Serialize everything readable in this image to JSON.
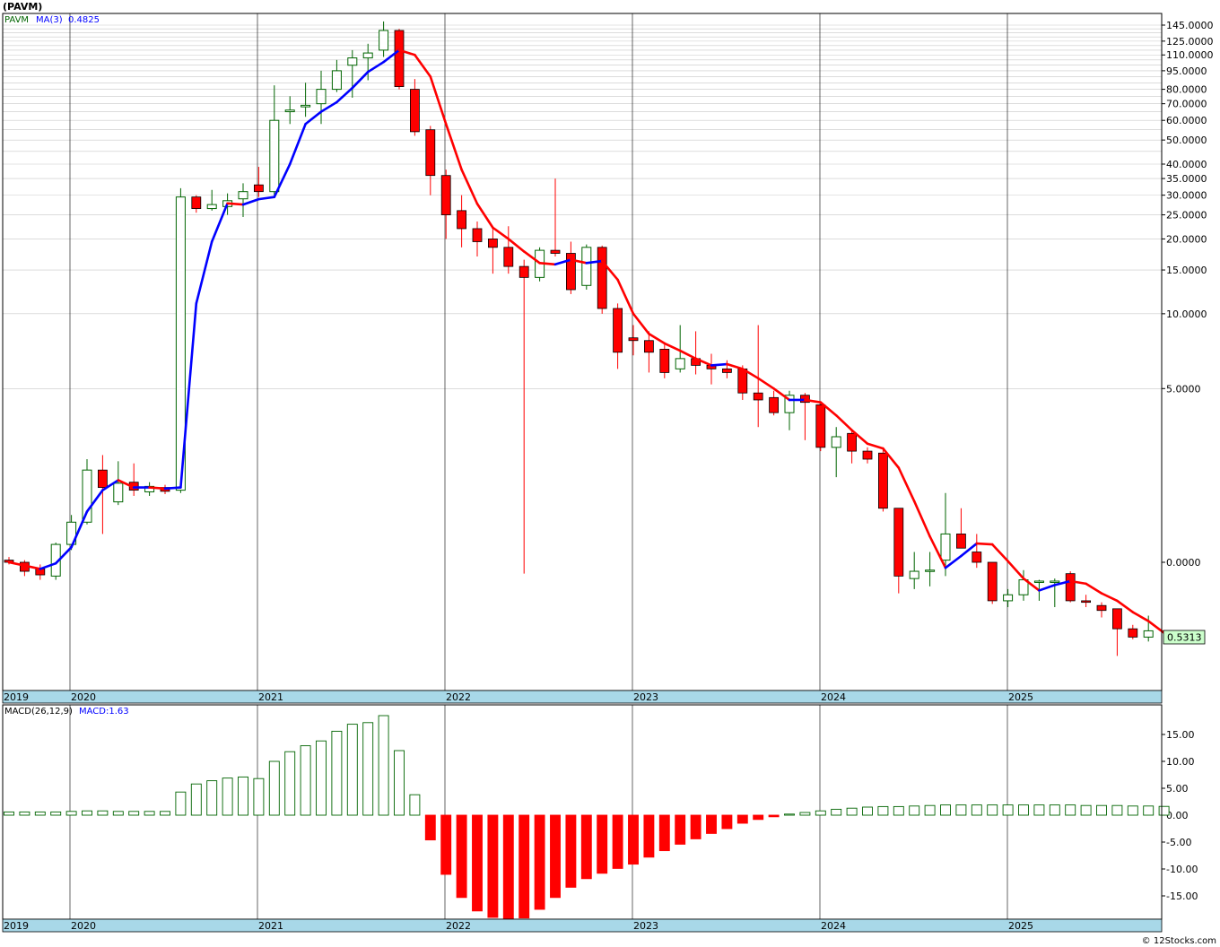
{
  "ticker_label": "(PAVM)",
  "price_legend": {
    "symbol": "PAVM",
    "ma_label": "MA(3)",
    "ma_value": "0.4825"
  },
  "macd_legend": {
    "label": "MACD(26,12,9)",
    "value_label": "MACD:1.63"
  },
  "last_price_badge": "0.5313",
  "credit": "© 12Stocks.com",
  "colors": {
    "up": "#006400",
    "down": "#ff0000",
    "ma_up": "#0000ff",
    "ma_down": "#ff0000",
    "axis_band": "#a8d8e8",
    "badge_bg": "#ccffcc"
  },
  "chart_data": [
    {
      "type": "candlestick",
      "scale": "log",
      "x_labels": [
        "2019",
        "2020",
        "2021",
        "2022",
        "2023",
        "2024",
        "2025"
      ],
      "y_tick_labels": [
        "145.0000",
        "125.0000",
        "110.0000",
        "95.0000",
        "80.0000",
        "70.0000",
        "60.0000",
        "50.0000",
        "40.0000",
        "35.0000",
        "30.0000",
        "25.0000",
        "20.0000",
        "15.0000",
        "10.0000",
        "5.0000",
        "0.0000"
      ],
      "y_ticks": [
        145,
        125,
        110,
        95,
        80,
        70,
        60,
        50,
        40,
        35,
        30,
        25,
        20,
        15,
        10,
        5,
        1
      ],
      "grid_lines": [
        145,
        140,
        135,
        130,
        125,
        120,
        115,
        110,
        105,
        100,
        95,
        90,
        85,
        80,
        75,
        70,
        65,
        60,
        55,
        50,
        45,
        40,
        35,
        30,
        25,
        20,
        15,
        10,
        5
      ],
      "candles": [
        {
          "o": 1.02,
          "h": 1.05,
          "l": 0.98,
          "c": 1.0
        },
        {
          "o": 1.0,
          "h": 1.02,
          "l": 0.88,
          "c": 0.92
        },
        {
          "o": 0.94,
          "h": 0.98,
          "l": 0.85,
          "c": 0.89
        },
        {
          "o": 0.88,
          "h": 1.2,
          "l": 0.85,
          "c": 1.18
        },
        {
          "o": 1.18,
          "h": 1.55,
          "l": 1.12,
          "c": 1.45
        },
        {
          "o": 1.45,
          "h": 2.6,
          "l": 1.42,
          "c": 2.35
        },
        {
          "o": 2.35,
          "h": 2.7,
          "l": 1.3,
          "c": 2.0
        },
        {
          "o": 1.75,
          "h": 2.55,
          "l": 1.7,
          "c": 2.08
        },
        {
          "o": 2.1,
          "h": 2.5,
          "l": 1.85,
          "c": 1.95
        },
        {
          "o": 1.92,
          "h": 2.1,
          "l": 1.85,
          "c": 2.02
        },
        {
          "o": 2.0,
          "h": 2.05,
          "l": 1.88,
          "c": 1.93
        },
        {
          "o": 1.95,
          "h": 32.0,
          "l": 1.9,
          "c": 29.5
        },
        {
          "o": 29.5,
          "h": 30.0,
          "l": 25.5,
          "c": 26.5
        },
        {
          "o": 26.5,
          "h": 31.5,
          "l": 26.0,
          "c": 27.5
        },
        {
          "o": 27.0,
          "h": 30.5,
          "l": 25.0,
          "c": 28.5
        },
        {
          "o": 29.0,
          "h": 33.5,
          "l": 24.5,
          "c": 31.0
        },
        {
          "o": 33.0,
          "h": 39.0,
          "l": 29.5,
          "c": 31.0
        },
        {
          "o": 31.0,
          "h": 83.0,
          "l": 30.0,
          "c": 60.0
        },
        {
          "o": 65.0,
          "h": 75.0,
          "l": 58.0,
          "c": 66.0
        },
        {
          "o": 68.0,
          "h": 85.0,
          "l": 62.0,
          "c": 69.0
        },
        {
          "o": 70.0,
          "h": 95.0,
          "l": 58.0,
          "c": 80.0
        },
        {
          "o": 80.0,
          "h": 105.0,
          "l": 78.0,
          "c": 95.0
        },
        {
          "o": 100.0,
          "h": 115.0,
          "l": 74.0,
          "c": 107.0
        },
        {
          "o": 107.0,
          "h": 122.0,
          "l": 87.0,
          "c": 112.0
        },
        {
          "o": 115.0,
          "h": 150.0,
          "l": 108.0,
          "c": 138.0
        },
        {
          "o": 138.0,
          "h": 140.0,
          "l": 80.0,
          "c": 82.0
        },
        {
          "o": 80.0,
          "h": 88.0,
          "l": 52.0,
          "c": 54.0
        },
        {
          "o": 55.0,
          "h": 57.0,
          "l": 30.0,
          "c": 36.0
        },
        {
          "o": 36.0,
          "h": 38.0,
          "l": 20.0,
          "c": 25.0
        },
        {
          "o": 26.0,
          "h": 30.0,
          "l": 18.5,
          "c": 22.0
        },
        {
          "o": 22.0,
          "h": 23.5,
          "l": 17.0,
          "c": 19.5
        },
        {
          "o": 20.0,
          "h": 22.0,
          "l": 14.5,
          "c": 18.5
        },
        {
          "o": 18.5,
          "h": 22.5,
          "l": 14.5,
          "c": 15.5
        },
        {
          "o": 15.5,
          "h": 16.5,
          "l": 0.9,
          "c": 14.0
        },
        {
          "o": 14.0,
          "h": 18.5,
          "l": 13.5,
          "c": 18.0
        },
        {
          "o": 18.0,
          "h": 35.0,
          "l": 17.0,
          "c": 17.5
        },
        {
          "o": 17.5,
          "h": 19.5,
          "l": 12.0,
          "c": 12.5
        },
        {
          "o": 13.0,
          "h": 19.0,
          "l": 12.5,
          "c": 18.5
        },
        {
          "o": 18.5,
          "h": 18.8,
          "l": 10.0,
          "c": 10.5
        },
        {
          "o": 10.5,
          "h": 11.0,
          "l": 6.0,
          "c": 7.0
        },
        {
          "o": 8.0,
          "h": 9.0,
          "l": 6.8,
          "c": 7.8
        },
        {
          "o": 7.8,
          "h": 8.5,
          "l": 5.8,
          "c": 7.0
        },
        {
          "o": 7.2,
          "h": 7.5,
          "l": 5.5,
          "c": 5.8
        },
        {
          "o": 6.0,
          "h": 9.0,
          "l": 5.8,
          "c": 6.6
        },
        {
          "o": 6.6,
          "h": 8.5,
          "l": 5.7,
          "c": 6.2
        },
        {
          "o": 6.2,
          "h": 6.9,
          "l": 5.2,
          "c": 6.0
        },
        {
          "o": 6.0,
          "h": 6.5,
          "l": 5.5,
          "c": 5.8
        },
        {
          "o": 6.0,
          "h": 6.2,
          "l": 4.5,
          "c": 4.8
        },
        {
          "o": 4.8,
          "h": 9.0,
          "l": 3.5,
          "c": 4.5
        },
        {
          "o": 4.6,
          "h": 4.9,
          "l": 3.9,
          "c": 4.0
        },
        {
          "o": 4.0,
          "h": 4.9,
          "l": 3.4,
          "c": 4.7
        },
        {
          "o": 4.7,
          "h": 4.8,
          "l": 3.1,
          "c": 4.4
        },
        {
          "o": 4.3,
          "h": 4.4,
          "l": 2.8,
          "c": 2.9
        },
        {
          "o": 2.9,
          "h": 3.5,
          "l": 2.2,
          "c": 3.2
        },
        {
          "o": 3.3,
          "h": 3.4,
          "l": 2.5,
          "c": 2.8
        },
        {
          "o": 2.8,
          "h": 2.9,
          "l": 2.5,
          "c": 2.6
        },
        {
          "o": 2.75,
          "h": 2.9,
          "l": 1.6,
          "c": 1.65
        },
        {
          "o": 1.65,
          "h": 1.65,
          "l": 0.75,
          "c": 0.88
        },
        {
          "o": 0.86,
          "h": 1.1,
          "l": 0.78,
          "c": 0.92
        },
        {
          "o": 0.92,
          "h": 1.1,
          "l": 0.8,
          "c": 0.93
        },
        {
          "o": 1.02,
          "h": 1.9,
          "l": 0.88,
          "c": 1.3
        },
        {
          "o": 1.3,
          "h": 1.65,
          "l": 1.15,
          "c": 1.14
        },
        {
          "o": 1.1,
          "h": 1.3,
          "l": 0.95,
          "c": 1.0
        },
        {
          "o": 1.0,
          "h": 1.0,
          "l": 0.68,
          "c": 0.7
        },
        {
          "o": 0.7,
          "h": 0.78,
          "l": 0.66,
          "c": 0.74
        },
        {
          "o": 0.74,
          "h": 0.93,
          "l": 0.7,
          "c": 0.85
        },
        {
          "o": 0.84,
          "h": 0.85,
          "l": 0.7,
          "c": 0.84
        },
        {
          "o": 0.84,
          "h": 0.86,
          "l": 0.66,
          "c": 0.84
        },
        {
          "o": 0.9,
          "h": 0.92,
          "l": 0.69,
          "c": 0.7
        },
        {
          "o": 0.7,
          "h": 0.74,
          "l": 0.66,
          "c": 0.69
        },
        {
          "o": 0.67,
          "h": 0.69,
          "l": 0.6,
          "c": 0.64
        },
        {
          "o": 0.65,
          "h": 0.65,
          "l": 0.42,
          "c": 0.54
        },
        {
          "o": 0.54,
          "h": 0.56,
          "l": 0.49,
          "c": 0.5
        },
        {
          "o": 0.5,
          "h": 0.61,
          "l": 0.48,
          "c": 0.53
        }
      ],
      "ma_values": [
        1.0,
        0.97,
        0.94,
        0.99,
        1.15,
        1.6,
        1.95,
        2.14,
        2.0,
        2.0,
        1.98,
        2.0,
        11.0,
        19.5,
        27.8,
        27.5,
        28.9,
        29.5,
        40.0,
        58.0,
        65.0,
        71.0,
        81.0,
        94.0,
        103.0,
        115.0,
        110.0,
        90.0,
        58.0,
        38.0,
        27.7,
        22.2,
        20.0,
        17.8,
        16.0,
        15.8,
        16.5,
        16.0,
        16.3,
        13.7,
        10.0,
        8.3,
        7.6,
        7.1,
        6.6,
        6.2,
        6.27,
        6.0,
        5.5,
        5.0,
        4.5,
        4.5,
        4.4,
        3.9,
        3.4,
        3.0,
        2.87,
        2.4,
        1.76,
        1.27,
        0.95,
        1.06,
        1.19,
        1.18,
        1.01,
        0.86,
        0.77,
        0.81,
        0.84,
        0.82,
        0.75,
        0.7,
        0.63,
        0.58,
        0.52
      ]
    },
    {
      "type": "histogram",
      "title": "MACD(26,12,9)",
      "y_tick_labels": [
        "15.00",
        "10.00",
        "5.00",
        "0.00",
        "-5.00",
        "-10.00",
        "-15.00"
      ],
      "y_ticks": [
        15,
        10,
        5,
        0,
        -5,
        -10,
        -15
      ],
      "ylim": [
        -19.5,
        19
      ],
      "values": [
        0.6,
        0.6,
        0.6,
        0.6,
        0.7,
        0.8,
        0.8,
        0.7,
        0.7,
        0.7,
        0.7,
        4.3,
        5.8,
        6.4,
        6.9,
        7.1,
        6.8,
        10.0,
        11.8,
        12.9,
        13.8,
        15.6,
        16.9,
        17.2,
        18.5,
        12.0,
        3.8,
        -4.6,
        -11.0,
        -15.3,
        -17.8,
        -19.0,
        -19.3,
        -19.1,
        -17.5,
        -15.3,
        -13.4,
        -11.8,
        -10.8,
        -9.9,
        -9.1,
        -7.8,
        -6.6,
        -5.4,
        -4.4,
        -3.4,
        -2.5,
        -1.5,
        -0.8,
        -0.3,
        0.2,
        0.5,
        0.8,
        1.1,
        1.3,
        1.5,
        1.6,
        1.6,
        1.7,
        1.8,
        1.9,
        1.9,
        1.9,
        1.9,
        1.9,
        1.9,
        1.9,
        1.9,
        1.9,
        1.8,
        1.8,
        1.8,
        1.7,
        1.7,
        1.63
      ]
    }
  ]
}
